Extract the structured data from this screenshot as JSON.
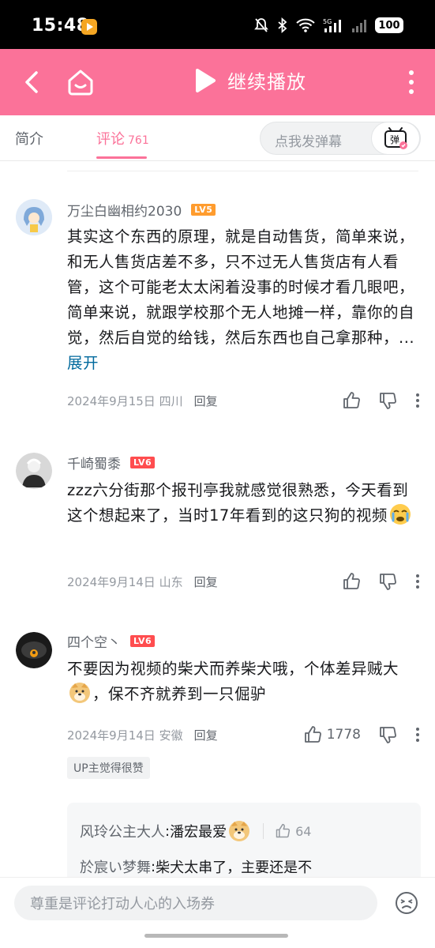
{
  "status": {
    "time": "15:48",
    "battery": "100",
    "network": "5G"
  },
  "header": {
    "resume_label": "继续播放"
  },
  "tabs": {
    "intro": "简介",
    "comments": "评论",
    "comments_count": "761"
  },
  "danmaku": {
    "placeholder": "点我发弹幕",
    "button_glyph": "弹"
  },
  "comments": [
    {
      "username": "万尘白幽相约2030",
      "level": "LV5",
      "text": "其实这个东西的原理，就是自动售货，简单来说，和无人售货店差不多，只不过无人售货店有人看管，这个可能老太太闲着没事的时候才看几眼吧，简单来说，就跟学校那个无人地摊一样，靠你的自觉，然后自觉的给钱，然后东西也自己拿那种，...",
      "expand": "展开",
      "date": "2024年9月15日",
      "location": "四川",
      "reply": "回复"
    },
    {
      "username": "千崎蜀黍",
      "level": "LV6",
      "text": "zzz六分街那个报刊亭我就感觉很熟悉，今天看到这个想起来了，当时17年看到的这只狗的视频",
      "date": "2024年9月14日",
      "location": "山东",
      "reply": "回复"
    },
    {
      "username": "四个空丶",
      "level": "LV6",
      "text_a": "不要因为视频的柴犬而养柴犬哦，个体差异贼大",
      "text_b": "，保不齐就养到一只倔驴",
      "date": "2024年9月14日",
      "location": "安徽",
      "reply": "回复",
      "likes": "1778",
      "up_badge": "UP主觉得很赞",
      "sub_replies": [
        {
          "name": "风玲公主大人",
          "text": "潘宏最爱",
          "likes": "64"
        },
        {
          "name": "於宸い梦舞",
          "text": "柴犬太串了，主要还是不"
        }
      ]
    }
  ],
  "bottom": {
    "placeholder": "尊重是评论打动人心的入场券"
  },
  "colors": {
    "brand": "#fb7299",
    "link": "#00699d",
    "lv5": "#ff9c2e",
    "lv6": "#ff4d4f"
  }
}
